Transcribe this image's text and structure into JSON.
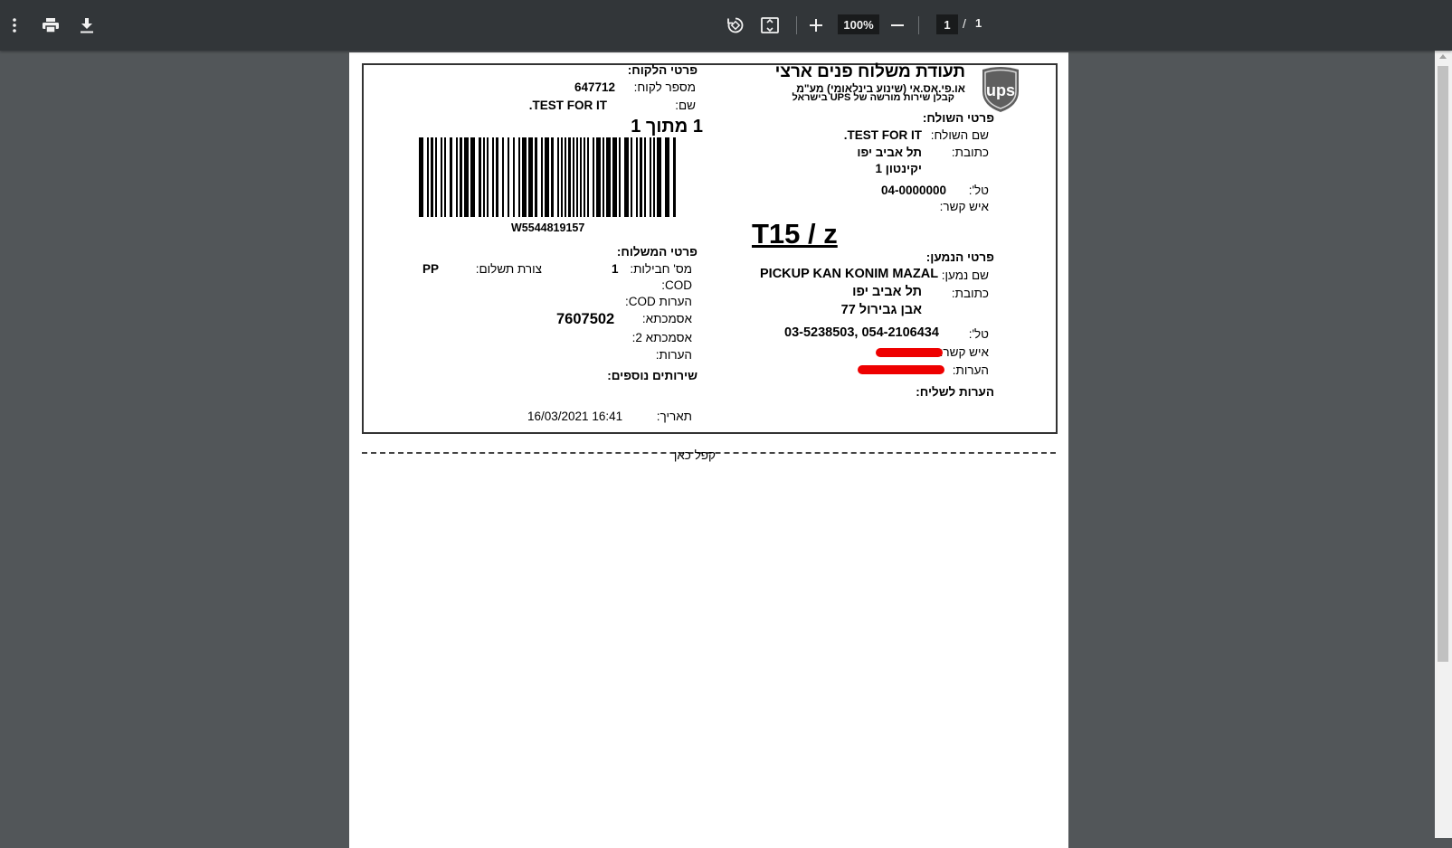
{
  "toolbar": {
    "zoom": "100%",
    "page_current": "1",
    "page_separator": "/",
    "page_total": "1"
  },
  "label": {
    "title": "תעודת משלוח פנים ארצי",
    "company_line1": "או.פי.אס.אי (שינוע בינלאומי) מע\"מ",
    "company_line2": "קבלן שירות מורשה של UPS בישראל",
    "customer": {
      "heading": "פרטי הלקוח:",
      "number_label": "מספר לקוח:",
      "number_value": "647712",
      "name_label": "שם:",
      "name_value": "TEST FOR IT."
    },
    "package_count": "1 מתוך 1",
    "barcode_text": "W5544819157",
    "sender": {
      "heading": "פרטי השולח:",
      "name_label": "שם השולח:",
      "name_value": "TEST FOR IT.",
      "address_label": "כתובת:",
      "city": "תל אביב יפו",
      "street": "יקינטון 1",
      "phone_label": "טל':",
      "phone_value": "04-0000000",
      "contact_label": "איש קשר:"
    },
    "route_code": "T15 / z",
    "recipient": {
      "heading": "פרטי הנמען:",
      "name_label": "שם נמען:",
      "name_value": "PICKUP KAN KONIM MAZAL",
      "address_label": "כתובת:",
      "city": "תל אביב יפו",
      "street": "אבן גבירול 77",
      "phone_label": "טל':",
      "phone_value": "03-5238503, 054-2106434",
      "contact_label": "איש קשר:",
      "notes_label": "הערות:"
    },
    "courier_notes_label": "הערות לשליח:",
    "shipment": {
      "heading": "פרטי המשלוח:",
      "packages_label": "מס' חבילות:",
      "packages_value": "1",
      "payment_label": "צורת תשלום:",
      "payment_value": "PP",
      "cod_label": "COD:",
      "cod_notes_label": "הערות COD:",
      "reference_label": "אסמכתא:",
      "reference_value": "7607502",
      "reference2_label": "אסמכתא 2:",
      "notes_label": "הערות:",
      "extra_services_label": "שירותים נוספים:",
      "date_label": "תאריך:",
      "date_value": "16/03/2021 16:41"
    },
    "fold_text": "קפל כאן",
    "logo_text": "ups"
  },
  "colors": {
    "toolbar": "#323639",
    "viewer_bg": "#525659",
    "redaction": "#ee0000",
    "logo_shield": "#5f5f5f"
  }
}
